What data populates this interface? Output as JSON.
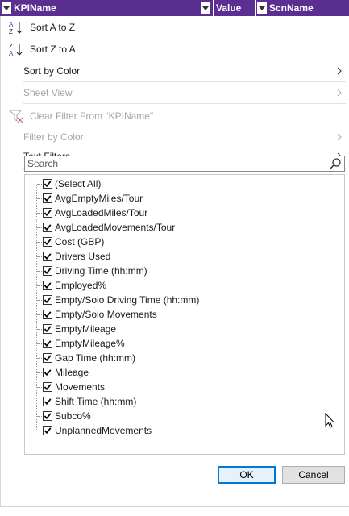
{
  "header": {
    "col1": "KPIName",
    "col2": "Value",
    "col3": "ScnName",
    "accent": "#5b2e91"
  },
  "menu": {
    "sort_az": "Sort A to Z",
    "sort_za": "Sort Z to A",
    "sort_by_color": "Sort by Color",
    "sheet_view": "Sheet View",
    "clear_filter": "Clear Filter From \"KPIName\"",
    "filter_by_color": "Filter by Color",
    "text_filters": "Text Filters"
  },
  "search": {
    "placeholder": "Search"
  },
  "list": {
    "items": [
      {
        "label": "(Select All)",
        "checked": true
      },
      {
        "label": "AvgEmptyMiles/Tour",
        "checked": true
      },
      {
        "label": "AvgLoadedMiles/Tour",
        "checked": true
      },
      {
        "label": "AvgLoadedMovements/Tour",
        "checked": true
      },
      {
        "label": "Cost (GBP)",
        "checked": true
      },
      {
        "label": "Drivers Used",
        "checked": true
      },
      {
        "label": "Driving Time (hh:mm)",
        "checked": true
      },
      {
        "label": "Employed%",
        "checked": true
      },
      {
        "label": "Empty/Solo Driving Time (hh:mm)",
        "checked": true
      },
      {
        "label": "Empty/Solo Movements",
        "checked": true
      },
      {
        "label": "EmptyMileage",
        "checked": true
      },
      {
        "label": "EmptyMileage%",
        "checked": true
      },
      {
        "label": "Gap Time (hh:mm)",
        "checked": true
      },
      {
        "label": "Mileage",
        "checked": true
      },
      {
        "label": "Movements",
        "checked": true
      },
      {
        "label": "Shift Time (hh:mm)",
        "checked": true
      },
      {
        "label": "Subco%",
        "checked": true
      },
      {
        "label": "UnplannedMovements",
        "checked": true
      }
    ]
  },
  "buttons": {
    "ok": "OK",
    "cancel": "Cancel"
  }
}
